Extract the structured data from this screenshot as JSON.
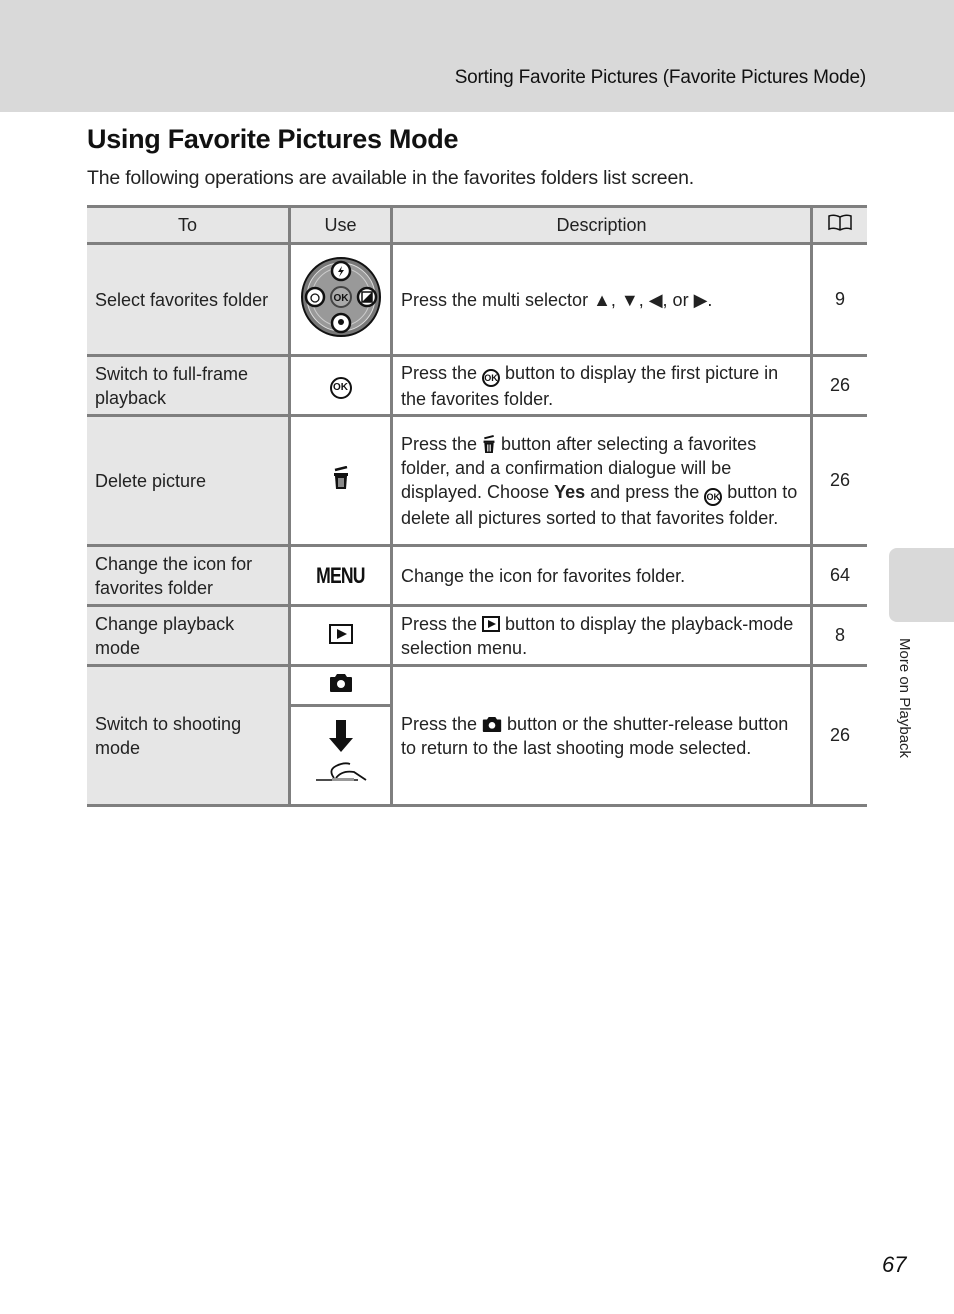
{
  "header": {
    "running_head": "Sorting Favorite Pictures (Favorite Pictures Mode)"
  },
  "page": {
    "title": "Using Favorite Pictures Mode",
    "intro": "The following operations are available in the favorites folders list screen.",
    "side_tab_label": "More on Playback",
    "page_number": "67"
  },
  "table": {
    "headers": {
      "to": "To",
      "use": "Use",
      "description": "Description",
      "ref_icon": "book-reference-icon"
    },
    "rows": [
      {
        "to": "Select favorites folder",
        "use_icon": "multi-selector-icon",
        "description": {
          "before": "Press the multi selector ",
          "arrows": "▲, ▼, ◀, or ▶",
          "after": "."
        },
        "ref": "9"
      },
      {
        "to": "Switch to full-frame playback",
        "use_icon": "ok-button-icon",
        "description": {
          "before": "Press the ",
          "after": " button to display the first picture in the favorites folder."
        },
        "ref": "26"
      },
      {
        "to": "Delete picture",
        "use_icon": "trash-icon",
        "description": {
          "before": "Press the ",
          "middle": " button after selecting a favorites folder, and a confirmation dialogue will be displayed. Choose ",
          "bold": "Yes",
          "middle2": " and press the ",
          "after": " button to delete all pictures sorted to that favorites folder."
        },
        "ref": "26"
      },
      {
        "to": "Change the icon for favorites folder",
        "use_label": "MENU",
        "use_icon": "menu-button-icon",
        "description": {
          "text": "Change the icon for favorites folder."
        },
        "ref": "64"
      },
      {
        "to": "Change playback mode",
        "use_icon": "playback-button-icon",
        "description": {
          "before": "Press the ",
          "after": " button to display the playback-mode selection menu."
        },
        "ref": "8"
      },
      {
        "to": "Switch to shooting mode",
        "use_icons": [
          "camera-icon",
          "shutter-release-icon"
        ],
        "description": {
          "before": "Press the ",
          "after": " button or the shutter-release button to return to the last shooting mode selected."
        },
        "ref": "26"
      }
    ]
  }
}
